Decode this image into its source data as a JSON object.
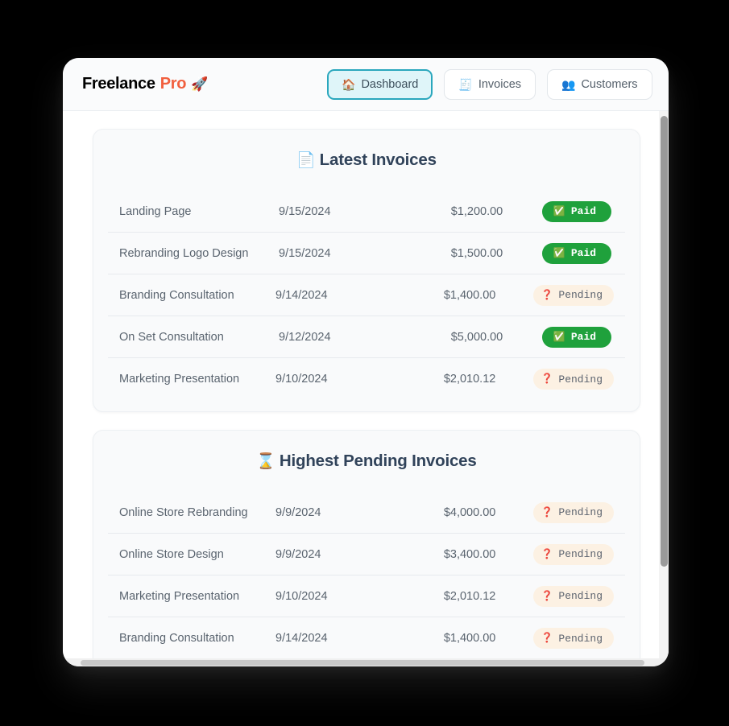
{
  "header": {
    "brand_first": "Freelance",
    "brand_second": "Pro",
    "brand_icon": "🚀",
    "brand_icon_name": "rocket-icon",
    "accent_color": "#f1603f",
    "brand_color": "#33475b",
    "nav": [
      {
        "label": "Dashboard",
        "icon": "🏠",
        "icon_name": "house-icon",
        "active": true
      },
      {
        "label": "Invoices",
        "icon": "🧾",
        "icon_name": "receipt-icon",
        "active": false
      },
      {
        "label": "Customers",
        "icon": "👥",
        "icon_name": "people-icon",
        "active": false
      }
    ]
  },
  "cards": [
    {
      "title": "Latest Invoices",
      "icon": "📄",
      "icon_name": "document-icon",
      "rows": [
        {
          "name": "Landing Page",
          "date": "9/15/2024",
          "amount": "$1,200.00",
          "status": "Paid",
          "status_icon": "✅"
        },
        {
          "name": "Rebranding Logo Design",
          "date": "9/15/2024",
          "amount": "$1,500.00",
          "status": "Paid",
          "status_icon": "✅"
        },
        {
          "name": "Branding Consultation",
          "date": "9/14/2024",
          "amount": "$1,400.00",
          "status": "Pending",
          "status_icon": "❓"
        },
        {
          "name": "On Set Consultation",
          "date": "9/12/2024",
          "amount": "$5,000.00",
          "status": "Paid",
          "status_icon": "✅"
        },
        {
          "name": "Marketing Presentation",
          "date": "9/10/2024",
          "amount": "$2,010.12",
          "status": "Pending",
          "status_icon": "❓"
        }
      ]
    },
    {
      "title": "Highest Pending Invoices",
      "icon": "⌛",
      "icon_name": "hourglass-icon",
      "rows": [
        {
          "name": "Online Store Rebranding",
          "date": "9/9/2024",
          "amount": "$4,000.00",
          "status": "Pending",
          "status_icon": "❓"
        },
        {
          "name": "Online Store Design",
          "date": "9/9/2024",
          "amount": "$3,400.00",
          "status": "Pending",
          "status_icon": "❓"
        },
        {
          "name": "Marketing Presentation",
          "date": "9/10/2024",
          "amount": "$2,010.12",
          "status": "Pending",
          "status_icon": "❓"
        },
        {
          "name": "Branding Consultation",
          "date": "9/14/2024",
          "amount": "$1,400.00",
          "status": "Pending",
          "status_icon": "❓"
        }
      ]
    }
  ],
  "status_colors": {
    "paid_bg": "#1fa13c",
    "paid_text": "#ffffff",
    "pending_bg": "#fcf1e3",
    "pending_text": "#5e6570"
  }
}
